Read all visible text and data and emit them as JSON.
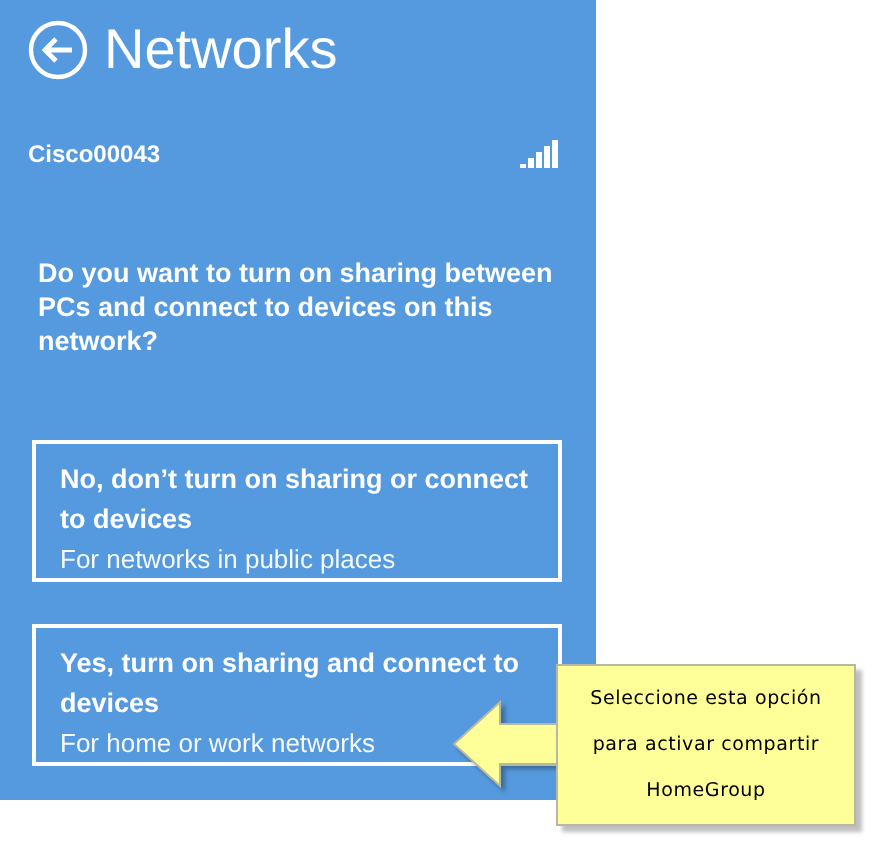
{
  "header": {
    "title": "Networks"
  },
  "network": {
    "name": "Cisco00043"
  },
  "question": "Do you want to turn on sharing between PCs and connect to devices on this network?",
  "options": [
    {
      "title": "No, don’t turn on sharing or connect to devices",
      "subtitle": "For networks in public places"
    },
    {
      "title": "Yes, turn on sharing and connect to devices",
      "subtitle": "For home or work networks"
    }
  ],
  "callout": {
    "lines": [
      "Seleccione esta opción",
      "para activar compartir",
      "HomeGroup"
    ]
  }
}
